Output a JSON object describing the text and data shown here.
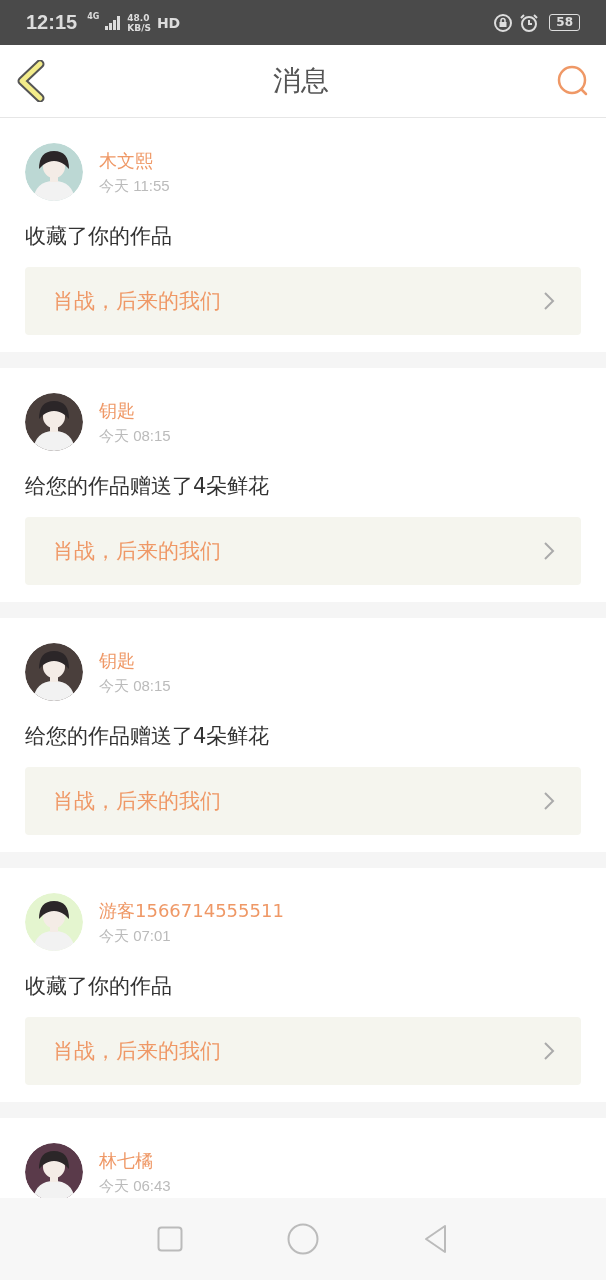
{
  "status_bar": {
    "time": "12:15",
    "network": "4G",
    "speed_value": "48.0",
    "speed_unit": "KB/S",
    "hd": "HD",
    "battery": "58"
  },
  "header": {
    "title": "消息"
  },
  "messages": [
    {
      "name": "木文熙",
      "time": "今天 11:55",
      "action": "收藏了你的作品",
      "work": "肖战，后来的我们"
    },
    {
      "name": "钥匙",
      "time": "今天 08:15",
      "action": "给您的作品赠送了4朵鲜花",
      "work": "肖战，后来的我们"
    },
    {
      "name": "钥匙",
      "time": "今天 08:15",
      "action": "给您的作品赠送了4朵鲜花",
      "work": "肖战，后来的我们"
    },
    {
      "name": "游客1566714555511",
      "time": "今天 07:01",
      "action": "收藏了你的作品",
      "work": "肖战，后来的我们"
    },
    {
      "name": "林七橘",
      "time": "今天 06:43"
    }
  ]
}
